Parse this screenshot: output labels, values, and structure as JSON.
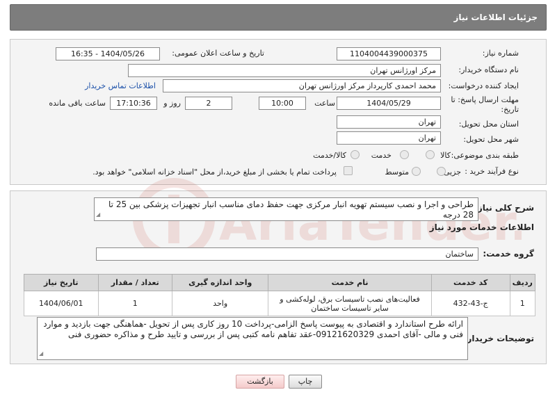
{
  "header": {
    "title": "جزئیات اطلاعات نیاز"
  },
  "form": {
    "need_number_label": "شماره نیاز:",
    "need_number": "1104004439000375",
    "announce_label": "تاریخ و ساعت اعلان عمومی:",
    "announce_value": "1404/05/26 - 16:35",
    "buyer_label": "نام دستگاه خریدار:",
    "buyer_value": "مرکز اورژانس تهران",
    "creator_label": "ایجاد کننده درخواست:",
    "creator_value": "محمد احمدی کارپرداز مرکز اورژانس تهران",
    "contact_link": "اطلاعات تماس خریدار",
    "deadline_label_1": "مهلت ارسال پاسخ: تا",
    "deadline_label_2": "تاریخ:",
    "deadline_date": "1404/05/29",
    "time_label": "ساعت",
    "deadline_time": "10:00",
    "days_value": "2",
    "days_label": "روز و",
    "remaining_value": "17:10:36",
    "remaining_label": "ساعت باقی مانده",
    "province_label": "استان محل تحویل:",
    "province_value": "تهران",
    "city_label": "شهر محل تحویل:",
    "city_value": "تهران",
    "category_label": "طبقه بندی موضوعی:",
    "category_options": [
      "کالا",
      "خدمت",
      "کالا/خدمت"
    ],
    "process_label": "نوع فرآیند خرید :",
    "process_options": [
      "جزیی",
      "متوسط"
    ],
    "payment_text": "پرداخت تمام یا بخشی از مبلغ خرید،از محل \"اسناد خزانه اسلامی\" خواهد بود."
  },
  "summary": {
    "label": "شرح کلی نیاز:",
    "text": "طراحی و اجرا و نصب سیستم تهویه انبار مرکزی جهت حفظ دمای مناسب انبار تجهیزات پزشکی بین 25 تا 28 درجه"
  },
  "services": {
    "section_title": "اطلاعات خدمات مورد نیاز",
    "group_label": "گروه خدمت:",
    "group_value": "ساختمان",
    "columns": [
      "ردیف",
      "کد خدمت",
      "نام خدمت",
      "واحد اندازه گیری",
      "تعداد / مقدار",
      "تاریخ نیاز"
    ],
    "rows": [
      {
        "row": "1",
        "code": "ج-43-432",
        "name": "فعالیت‌های نصب تاسیسات برق، لوله‌کشی و سایر تاسیسات ساختمان",
        "unit": "واحد",
        "qty": "1",
        "date": "1404/06/01"
      }
    ]
  },
  "buyer_notes": {
    "label": "توضیحات خریدار:",
    "text": "ارائه طرح استاندارد و اقتصادی به پیوست پاسخ الزامی-پرداخت 10 روز کاری پس از تحویل -هماهنگی جهت بازدید و موارد فنی و مالی -آقای احمدی 09121620329-عقد تفاهم نامه کتبی پس از بررسی و تایید طرح و مذاکره حضوری فنی"
  },
  "buttons": {
    "print": "چاپ",
    "back": "بازگشت"
  },
  "watermark": "AriaTender.net",
  "colors": {
    "titlebar": "#7d7d7d",
    "link": "#1a4fa8",
    "watermark": "#c0392b"
  }
}
